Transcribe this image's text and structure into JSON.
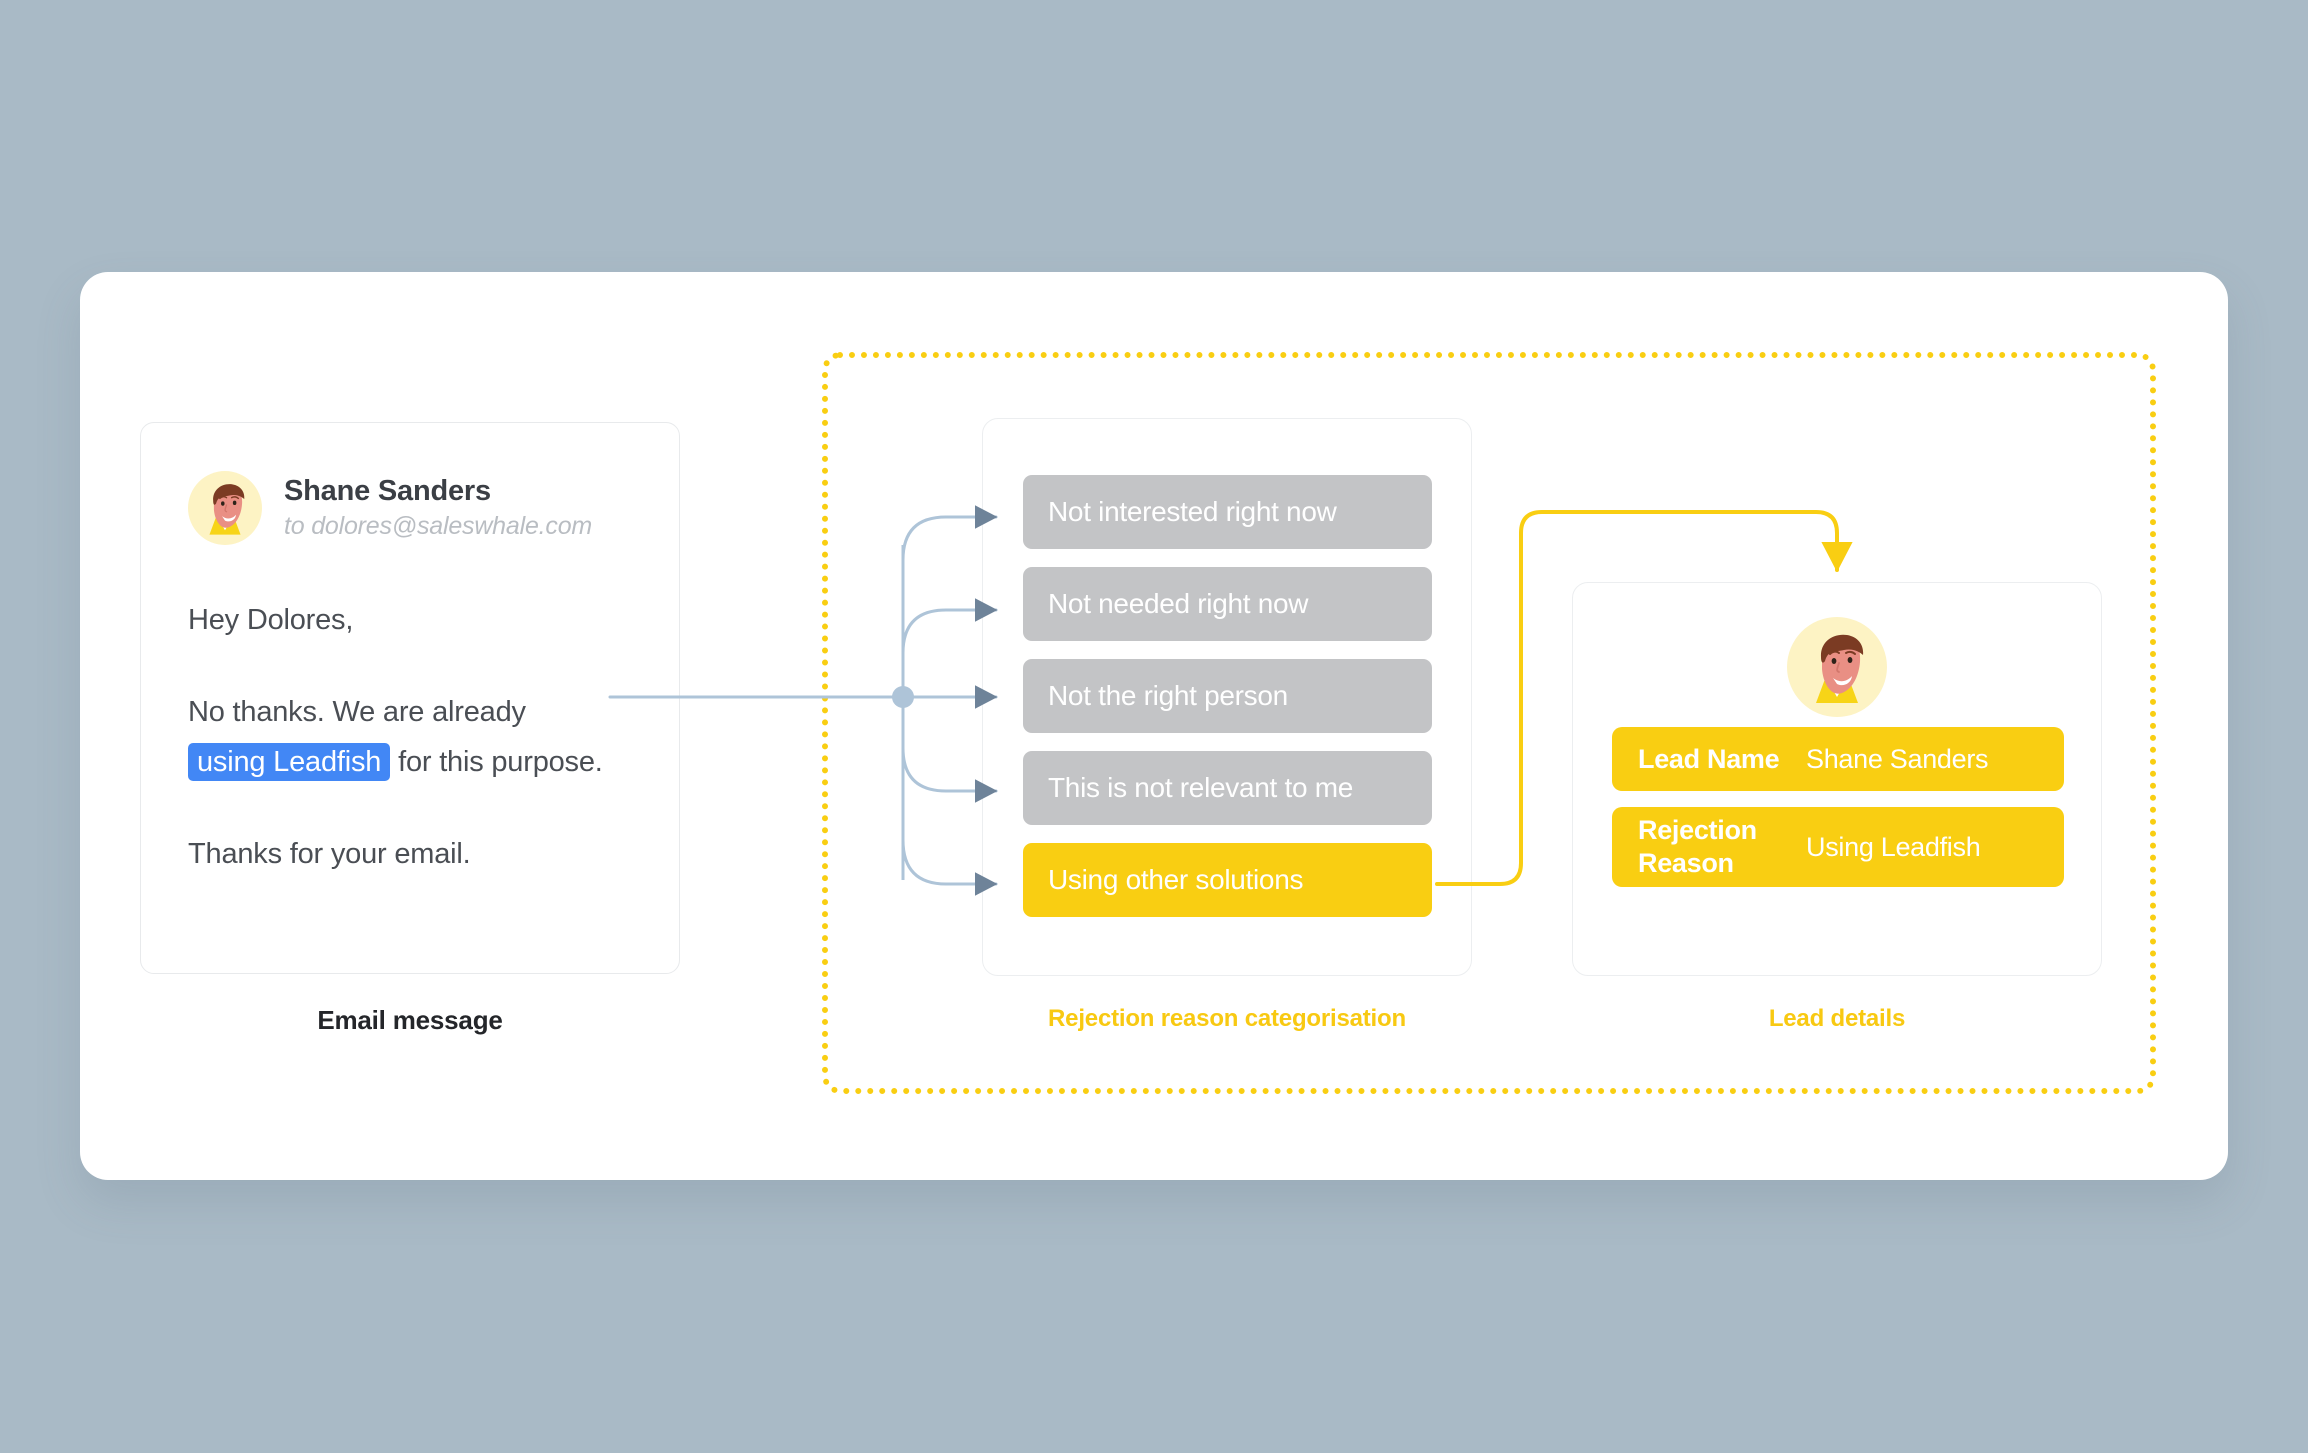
{
  "email": {
    "sender_name": "Shane Sanders",
    "recipient_line": "to dolores@saleswhale.com",
    "greeting": "Hey Dolores,",
    "body_before_highlight": "No thanks. We are already ",
    "highlight": "using Leadfish",
    "body_after_highlight": " for this purpose.",
    "closing": "Thanks for your email.",
    "caption": "Email message",
    "highlight_color": "#4287f5",
    "avatar_name": "shane-sanders-avatar"
  },
  "categorisation": {
    "caption": "Rejection reason categorisation",
    "options": [
      {
        "label": "Not interested right now",
        "selected": false
      },
      {
        "label": "Not needed right now",
        "selected": false
      },
      {
        "label": "Not the right person",
        "selected": false
      },
      {
        "label": "This is not relevant to me",
        "selected": false
      },
      {
        "label": "Using other solutions",
        "selected": true
      }
    ],
    "unselected_color": "#c3c4c6",
    "selected_color": "#f9ce12"
  },
  "lead_details": {
    "caption": "Lead details",
    "avatar_name": "shane-sanders-avatar-large",
    "rows": [
      {
        "label": "Lead Name",
        "value": "Shane Sanders"
      },
      {
        "label": "Rejection Reason",
        "value": "Using Leadfish"
      }
    ],
    "row_color": "#f9ce12"
  },
  "theme": {
    "page_background": "#a9bac6",
    "panel_background": "#ffffff",
    "accent_yellow": "#f9ce12",
    "connector_blue": "#aec4d8",
    "connector_arrow": "#6e8399"
  }
}
